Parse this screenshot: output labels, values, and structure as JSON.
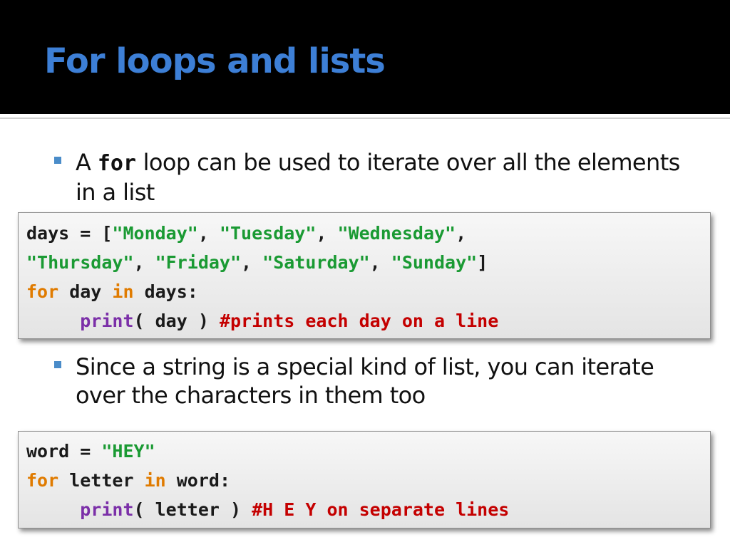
{
  "slide": {
    "title": "For loops and lists",
    "bullets": [
      {
        "pre": "A ",
        "code": "for",
        "post": " loop can be used to iterate over all the elements in a list"
      },
      {
        "text": "Since a string is a special kind of list, you can iterate over the characters in them too"
      }
    ],
    "code_block_1": {
      "line1": {
        "a": "days = [",
        "b": "\"Monday\"",
        "c": ", ",
        "d": "\"Tuesday\"",
        "e": ", ",
        "f": "\"Wednesday\"",
        "g": ","
      },
      "line2": {
        "a": "\"Thursday\"",
        "b": ", ",
        "c": "\"Friday\"",
        "d": ", ",
        "e": "\"Saturday\"",
        "f": ", ",
        "g": "\"Sunday\"",
        "h": "]"
      },
      "line3": {
        "a": "for",
        "b": " day ",
        "c": "in",
        "d": " days:"
      },
      "line4": {
        "indent": "     ",
        "a": "print",
        "b": "( day ) ",
        "c": "#prints each day on a line"
      }
    },
    "code_block_2": {
      "line1": {
        "a": "word = ",
        "b": "\"HEY\""
      },
      "line2": {
        "a": "for",
        "b": " letter ",
        "c": "in",
        "d": " word:"
      },
      "line3": {
        "indent": "     ",
        "a": "print",
        "b": "( letter ) ",
        "c": "#H E Y on separate lines"
      }
    }
  },
  "colors": {
    "title": "#3d7fd6",
    "bullet": "#4a8cc9",
    "string": "#1a9a33",
    "keyword": "#e07b00",
    "function": "#7b2fa8",
    "comment": "#c40000"
  }
}
